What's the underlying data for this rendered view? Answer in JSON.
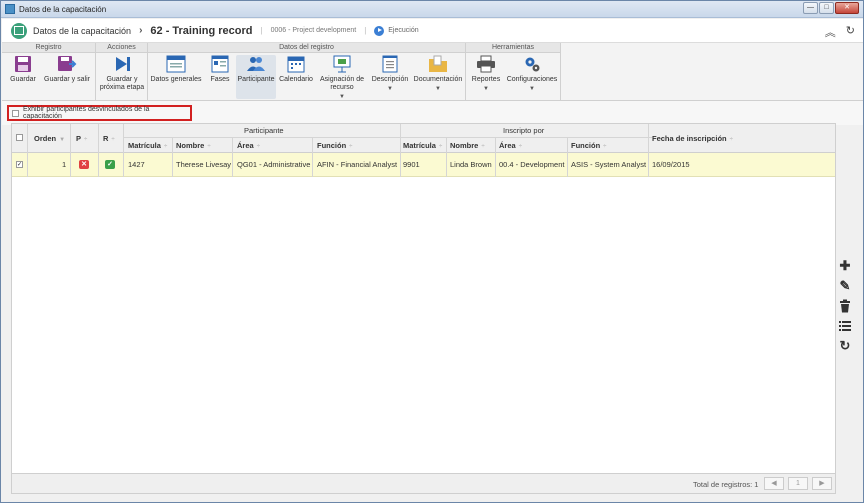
{
  "window": {
    "title": "Datos de la capacitación"
  },
  "header": {
    "module": "Datos de la capacitación",
    "separator": "›",
    "record": "62 - Training record",
    "project": "0006 - Project development",
    "status": "Ejecución"
  },
  "toolbar": {
    "groups": {
      "registro": "Registro",
      "acciones": "Acciones",
      "datos": "Datos del registro",
      "herramientas": "Herramientas"
    },
    "guardar": "Guardar",
    "guardar_salir": "Guardar y salir",
    "guardar_proxima_1": "Guardar y",
    "guardar_proxima_2": "próxima etapa",
    "datos_generales": "Datos generales",
    "fases": "Fases",
    "participante": "Participante",
    "calendario": "Calendario",
    "asignacion_1": "Asignación de",
    "asignacion_2": "recurso",
    "descripcion": "Descripción",
    "documentacion": "Documentación",
    "reportes": "Reportes",
    "configuraciones": "Configuraciones"
  },
  "filter": {
    "label": "Exhibir participantes desvinculados de la capacitación",
    "checked": false
  },
  "grid": {
    "headers": {
      "orden": "Orden",
      "p": "P",
      "r": "R",
      "participante": "Participante",
      "inscripto": "Inscripto por",
      "fecha": "Fecha de inscripción",
      "matricula": "Matrícula",
      "nombre": "Nombre",
      "area": "Área",
      "funcion": "Función"
    },
    "row": {
      "orden": "1",
      "p_matricula": "1427",
      "p_nombre": "Therese Livesay",
      "p_area": "QG01 - Administrative",
      "p_funcion": "AFIN - Financial Analyst",
      "i_matricula": "9901",
      "i_nombre": "Linda Brown",
      "i_area": "00.4 - Development",
      "i_funcion": "ASIS - System Analyst",
      "fecha": "16/09/2015"
    }
  },
  "footer": {
    "total": "Total de registros: 1",
    "page": "1"
  },
  "colors": {
    "row_selected": "#fbfad2",
    "accent": "#3b7fd4",
    "highlight_border": "#d22020"
  }
}
